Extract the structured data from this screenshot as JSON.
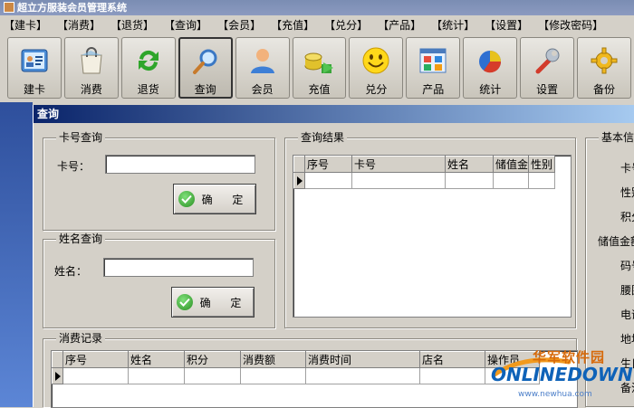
{
  "window": {
    "title": "超立方服装会员管理系统"
  },
  "menu": [
    "【建卡】",
    "【消费】",
    "【退货】",
    "【查询】",
    "【会员】",
    "【充值】",
    "【兑分】",
    "【产品】",
    "【统计】",
    "【设置】",
    "【修改密码】"
  ],
  "toolbar": {
    "buttons": [
      {
        "label": "建卡",
        "icon": "id-card-icon"
      },
      {
        "label": "消费",
        "icon": "shopping-bag-icon"
      },
      {
        "label": "退货",
        "icon": "refresh-arrows-icon"
      },
      {
        "label": "查询",
        "icon": "magnifier-icon",
        "active": true
      },
      {
        "label": "会员",
        "icon": "user-icon"
      },
      {
        "label": "充值",
        "icon": "coins-icon"
      },
      {
        "label": "兑分",
        "icon": "smiley-icon"
      },
      {
        "label": "产品",
        "icon": "product-grid-icon"
      },
      {
        "label": "统计",
        "icon": "pie-chart-icon"
      },
      {
        "label": "设置",
        "icon": "wrench-icon"
      },
      {
        "label": "备份",
        "icon": "gear-icon"
      }
    ]
  },
  "query_window": {
    "title": "查询",
    "card_query": {
      "legend": "卡号查询",
      "label": "卡号：",
      "value": "",
      "button": "确 定"
    },
    "name_query": {
      "legend": "姓名查询",
      "label": "姓名：",
      "value": "",
      "button": "确 定"
    },
    "results": {
      "legend": "查询结果",
      "columns": [
        "序号",
        "卡号",
        "姓名",
        "储值金",
        "性别"
      ]
    },
    "basic_info": {
      "legend": "基本信",
      "labels": [
        "卡号",
        "性别",
        "积分",
        "储值金额",
        "码号",
        "腰围",
        "电话",
        "地址",
        "生日",
        "备注"
      ]
    },
    "consumption": {
      "legend": "消费记录",
      "columns": [
        "序号",
        "姓名",
        "积分",
        "消费额",
        "消费时间",
        "店名",
        "操作员"
      ]
    }
  },
  "watermark": {
    "cn": "华军软件园",
    "en": "ONLINEDOWN",
    "url": "www.newhua.com"
  }
}
